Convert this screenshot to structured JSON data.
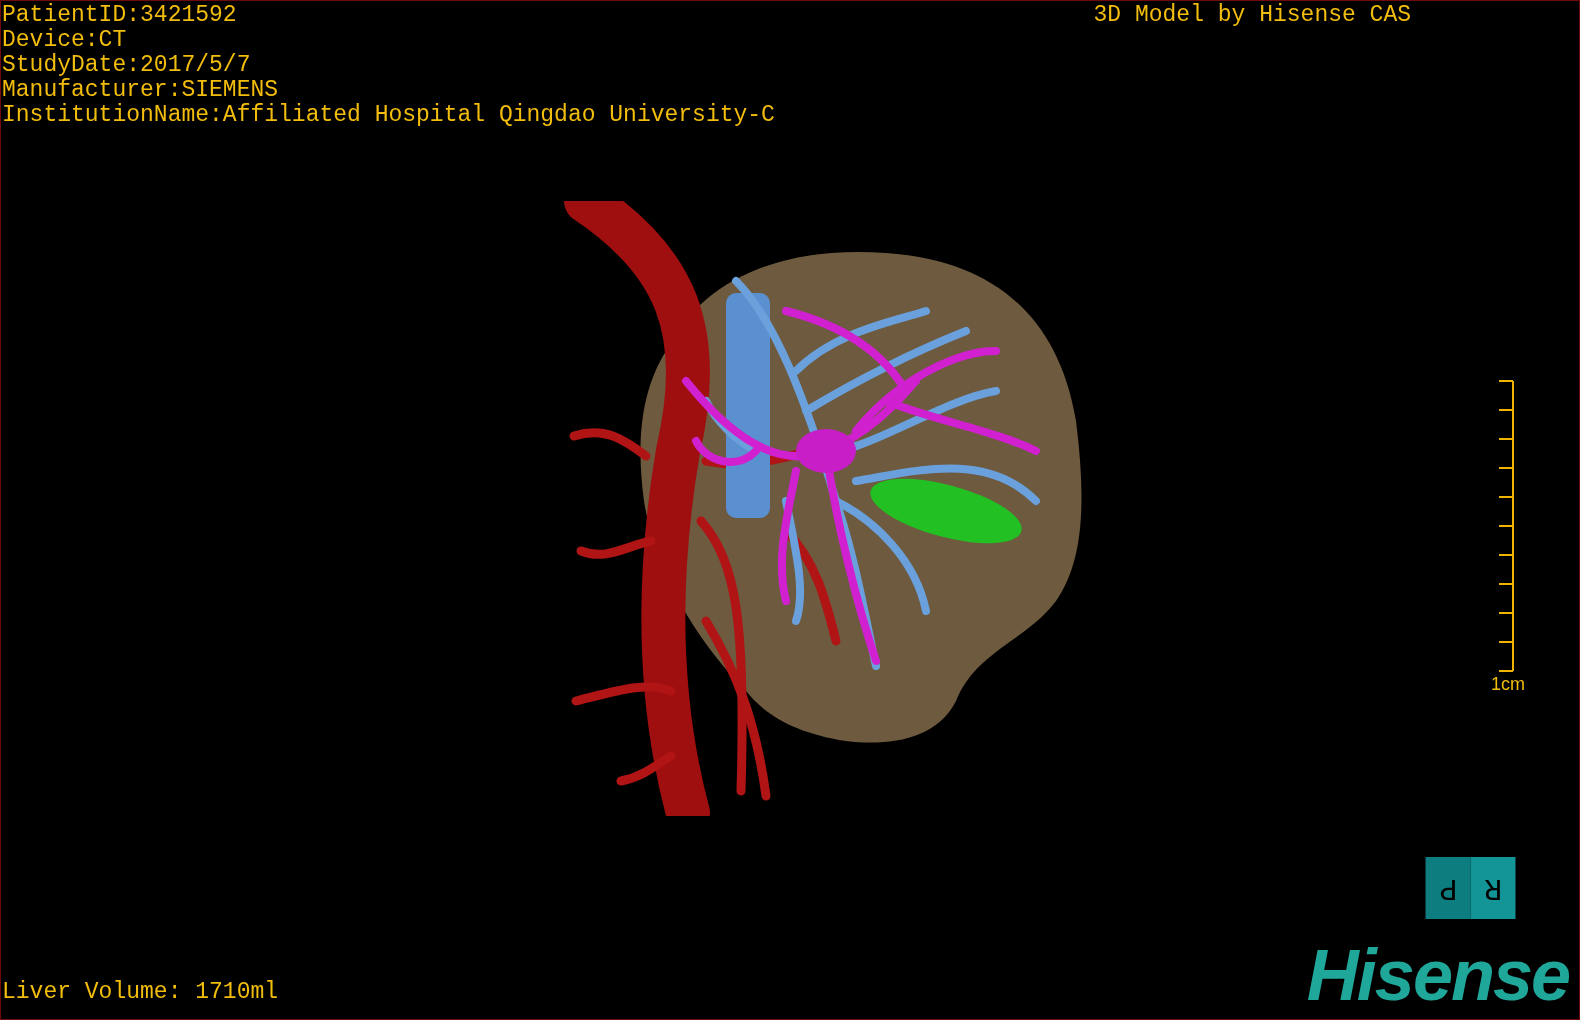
{
  "info": [
    "PatientID:3421592",
    "Device:CT",
    "StudyDate:2017/5/7",
    "Manufacturer:SIEMENS",
    "InstitutionName:Affiliated Hospital Qingdao University-C"
  ],
  "title": "3D Model by Hisense CAS",
  "scale_bar": {
    "label": "1cm"
  },
  "orientation_cube": {
    "faces": [
      "P",
      "R"
    ]
  },
  "liver_volume": "Liver Volume: 1710ml",
  "logo": "Hisense"
}
